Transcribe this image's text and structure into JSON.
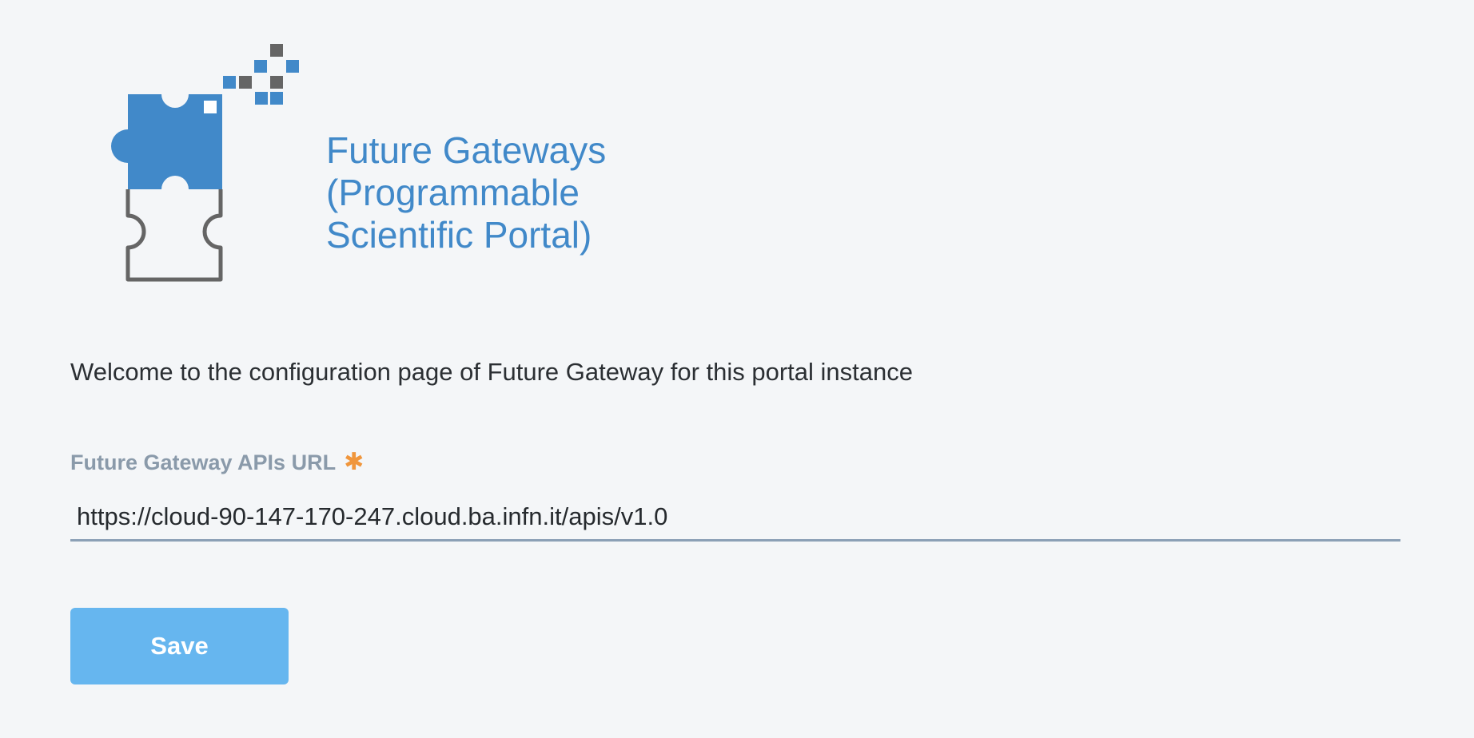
{
  "branding": {
    "title": "Future Gateways\n(Programmable\nScientific Portal)",
    "logo_icon": "puzzle-pieces-icon",
    "accent_color": "#4189c9",
    "secondary_color": "#656565"
  },
  "main": {
    "welcome_text": "Welcome to the configuration page of Future Gateway for this portal instance"
  },
  "form": {
    "url_label": "Future Gateway APIs URL",
    "required_marker": "✱",
    "url_value": "https://cloud-90-147-170-247.cloud.ba.infn.it/apis/v1.0",
    "save_label": "Save",
    "button_color": "#66b6ef",
    "required_color": "#f0963c"
  }
}
